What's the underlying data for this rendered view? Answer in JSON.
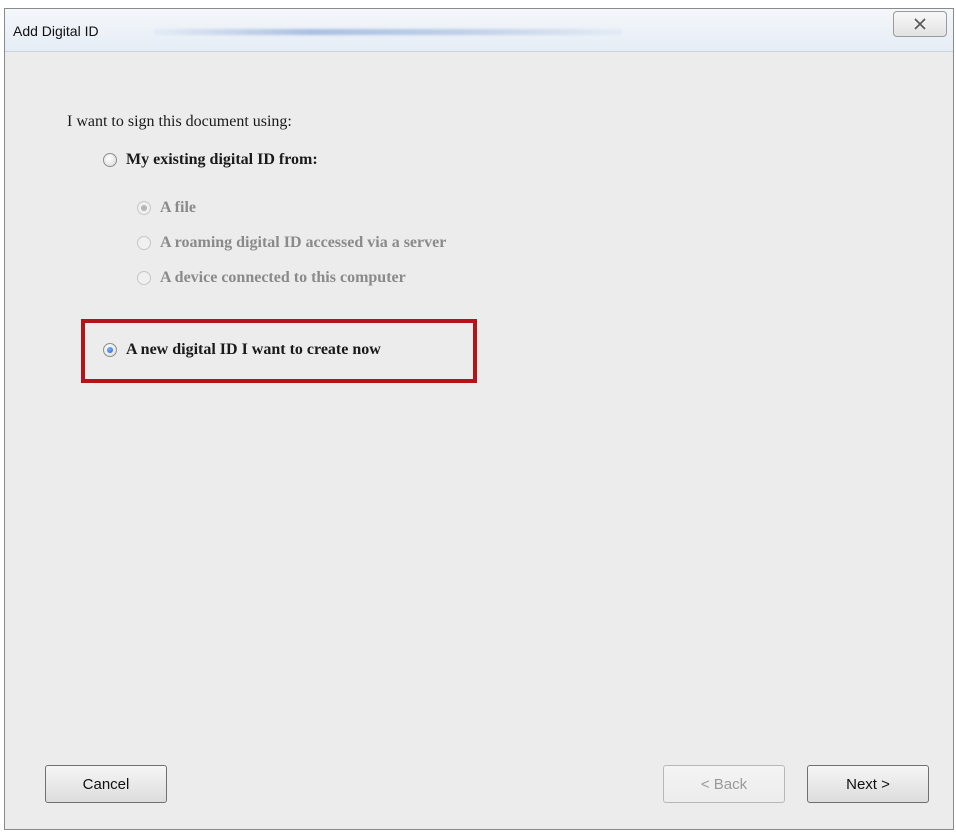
{
  "window": {
    "title": "Add Digital ID"
  },
  "form": {
    "prompt": "I want to sign this document using:",
    "options": {
      "existing": "My existing digital ID from:",
      "file": "A file",
      "roaming": "A roaming digital ID accessed via a server",
      "device": "A device connected to this computer",
      "new": "A new digital ID I want to create now"
    },
    "selected": "new"
  },
  "buttons": {
    "cancel": "Cancel",
    "back": "< Back",
    "next": "Next >"
  },
  "colors": {
    "highlight": "#b3131a"
  }
}
